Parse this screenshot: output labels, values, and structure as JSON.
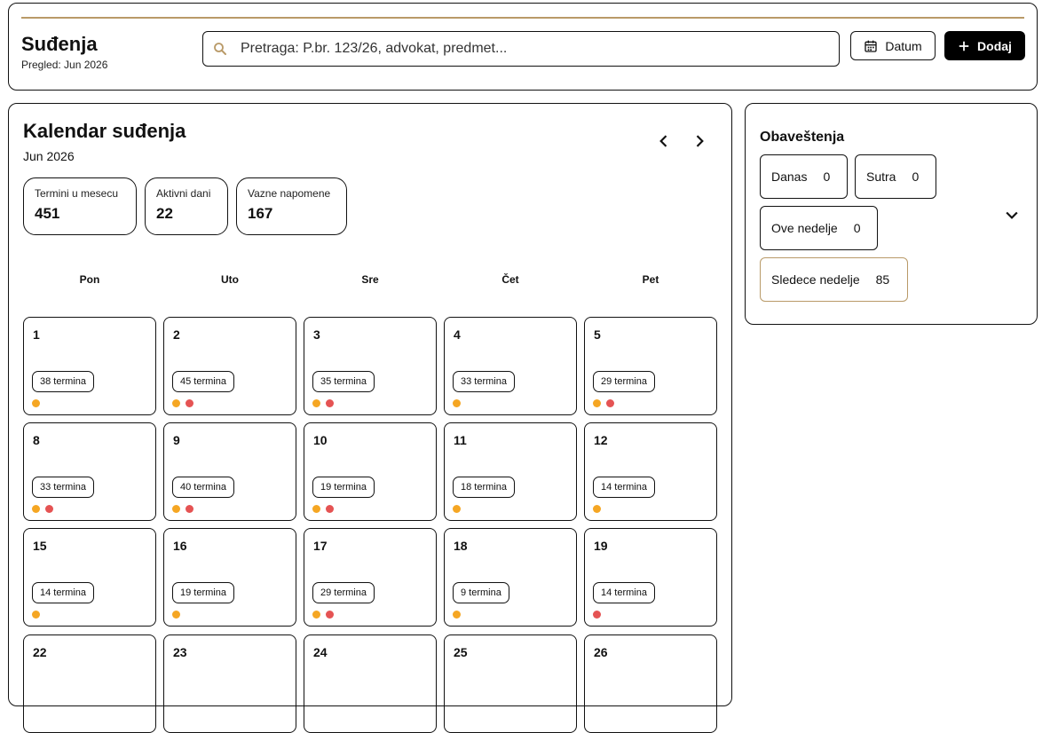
{
  "header": {
    "title": "Suđenja",
    "subtitle": "Pregled: Jun 2026",
    "search_placeholder": "Pretraga: P.br. 123/26, advokat, predmet...",
    "datum_label": "Datum",
    "dodaj_label": "Dodaj"
  },
  "calendar": {
    "title": "Kalendar suđenja",
    "month": "Jun 2026",
    "stats": [
      {
        "label": "Termini u mesecu",
        "value": "451"
      },
      {
        "label": "Aktivni dani",
        "value": "22"
      },
      {
        "label": "Vazne napomene",
        "value": "167"
      }
    ],
    "weekdays": [
      "Pon",
      "Uto",
      "Sre",
      "Čet",
      "Pet"
    ],
    "days": [
      {
        "day": "1",
        "badge": "38 termina",
        "dots": [
          "orange"
        ]
      },
      {
        "day": "2",
        "badge": "45 termina",
        "dots": [
          "orange",
          "red"
        ]
      },
      {
        "day": "3",
        "badge": "35 termina",
        "dots": [
          "orange",
          "red"
        ]
      },
      {
        "day": "4",
        "badge": "33 termina",
        "dots": [
          "orange"
        ]
      },
      {
        "day": "5",
        "badge": "29 termina",
        "dots": [
          "orange",
          "red"
        ]
      },
      {
        "day": "8",
        "badge": "33 termina",
        "dots": [
          "orange",
          "red"
        ]
      },
      {
        "day": "9",
        "badge": "40 termina",
        "dots": [
          "orange",
          "red"
        ]
      },
      {
        "day": "10",
        "badge": "19 termina",
        "dots": [
          "orange",
          "red"
        ]
      },
      {
        "day": "11",
        "badge": "18 termina",
        "dots": [
          "orange"
        ]
      },
      {
        "day": "12",
        "badge": "14 termina",
        "dots": [
          "orange"
        ]
      },
      {
        "day": "15",
        "badge": "14 termina",
        "dots": [
          "orange"
        ]
      },
      {
        "day": "16",
        "badge": "19 termina",
        "dots": [
          "orange"
        ]
      },
      {
        "day": "17",
        "badge": "29 termina",
        "dots": [
          "orange",
          "red"
        ]
      },
      {
        "day": "18",
        "badge": "9 termina",
        "dots": [
          "orange"
        ]
      },
      {
        "day": "19",
        "badge": "14 termina",
        "dots": [
          "red"
        ]
      },
      {
        "day": "22",
        "badge": "",
        "dots": []
      },
      {
        "day": "23",
        "badge": "",
        "dots": []
      },
      {
        "day": "24",
        "badge": "",
        "dots": []
      },
      {
        "day": "25",
        "badge": "",
        "dots": []
      },
      {
        "day": "26",
        "badge": "",
        "dots": []
      }
    ]
  },
  "notifications": {
    "title": "Obaveštenja",
    "items": [
      {
        "label": "Danas",
        "count": "0",
        "highlight": false
      },
      {
        "label": "Sutra",
        "count": "0",
        "highlight": false
      },
      {
        "label": "Ove nedelje",
        "count": "0",
        "highlight": false
      },
      {
        "label": "Sledece nedelje",
        "count": "85",
        "highlight": true
      }
    ]
  },
  "colors": {
    "accent_gold": "#b99a68",
    "dot_orange": "#f5a623",
    "dot_red": "#e55353"
  }
}
